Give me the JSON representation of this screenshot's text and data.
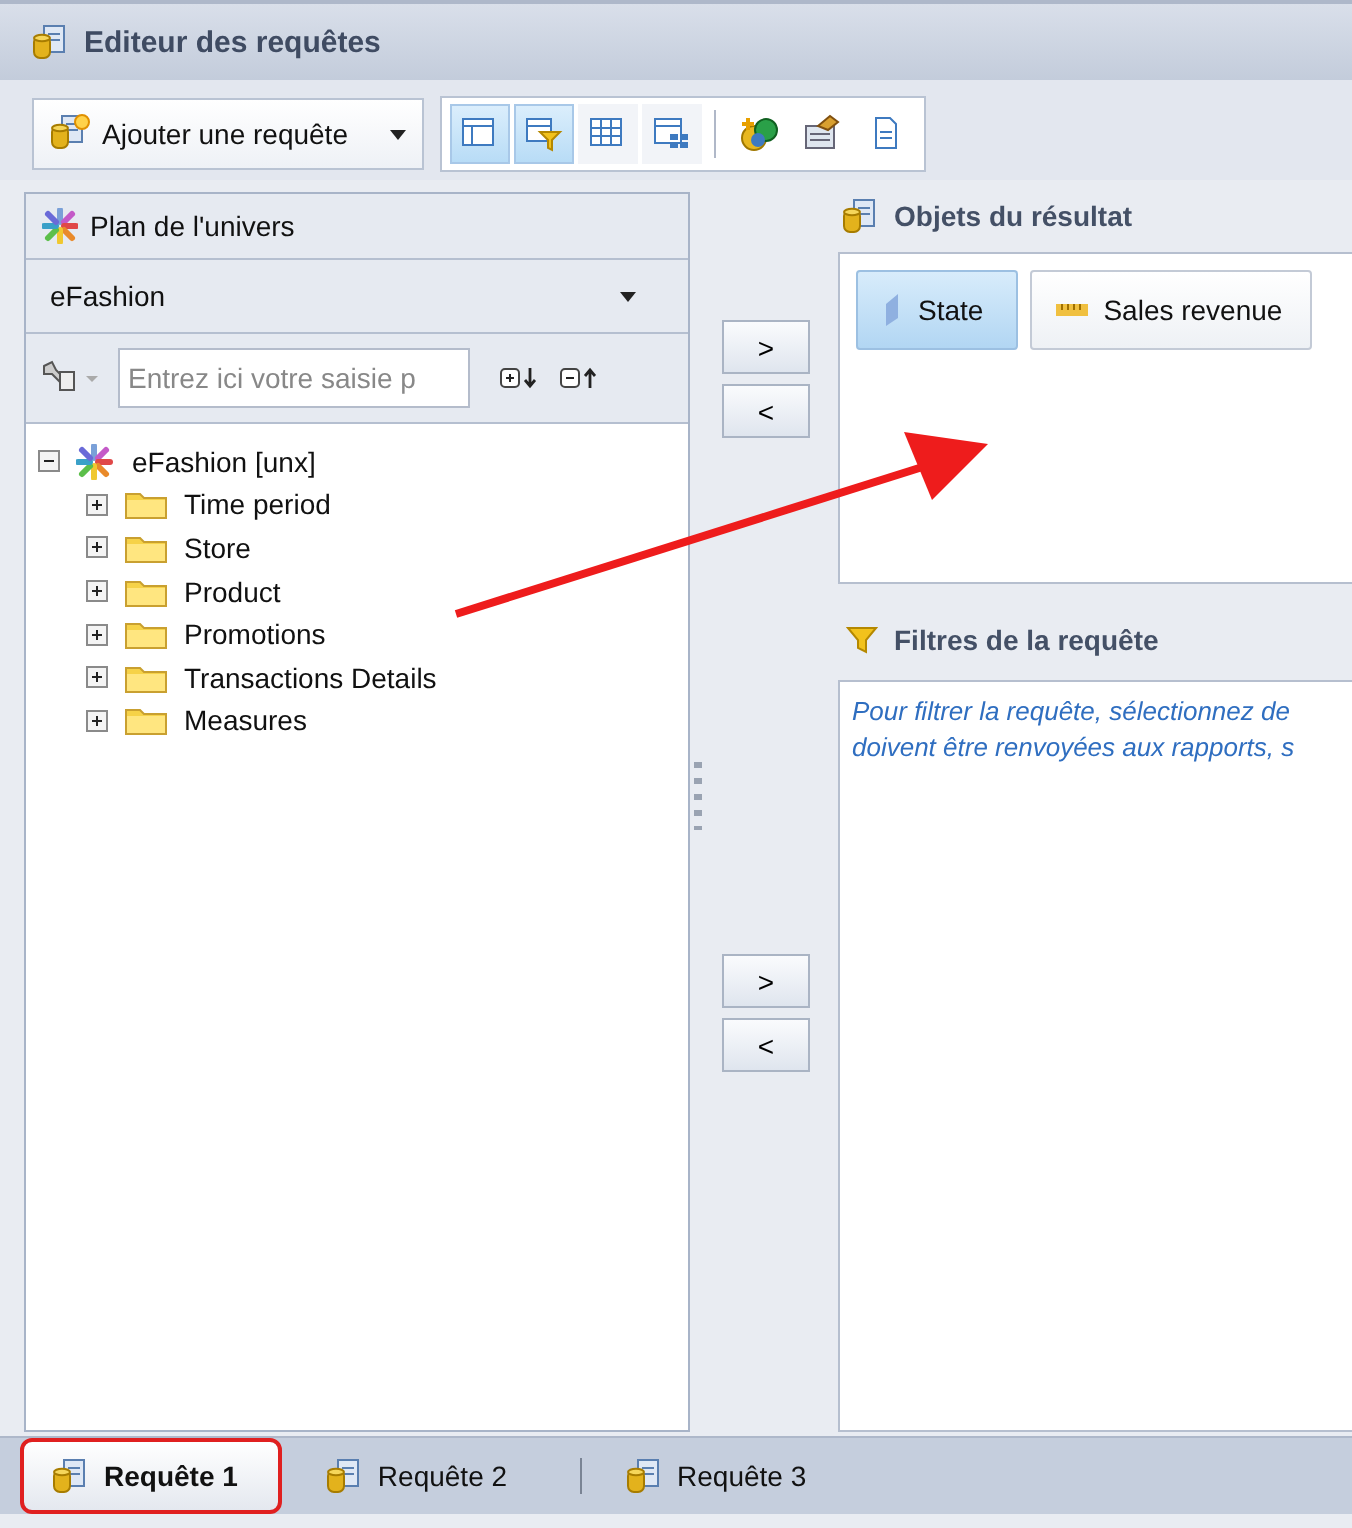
{
  "window": {
    "title": "Editeur des requêtes"
  },
  "toolbar": {
    "add_query": "Ajouter une requête",
    "view_buttons": [
      {
        "selected": true
      },
      {
        "selected": true
      },
      {
        "selected": false
      },
      {
        "selected": false
      }
    ]
  },
  "universe_panel": {
    "title": "Plan de l'univers",
    "universe": "eFashion",
    "search": {
      "placeholder": "Entrez ici votre saisie p"
    },
    "tree": [
      {
        "label": "eFashion [unx]",
        "kind": "universe",
        "expanded": true,
        "children": [
          {
            "label": "Time period",
            "kind": "folder",
            "expanded": false
          },
          {
            "label": "Store",
            "kind": "folder",
            "expanded": false
          },
          {
            "label": "Product",
            "kind": "folder",
            "expanded": false
          },
          {
            "label": "Promotions",
            "kind": "folder",
            "expanded": false
          },
          {
            "label": "Transactions Details",
            "kind": "folder",
            "expanded": false
          },
          {
            "label": "Measures",
            "kind": "folder",
            "expanded": false
          }
        ]
      }
    ]
  },
  "transfer_buttons": [
    [
      ">",
      "<"
    ],
    [
      ">",
      "<"
    ]
  ],
  "result_objects": {
    "title": "Objets du résultat",
    "items": [
      {
        "label": "State",
        "kind": "dimension",
        "selected": true
      },
      {
        "label": "Sales revenue",
        "kind": "measure",
        "selected": false
      }
    ]
  },
  "query_filters": {
    "title": "Filtres de la requête",
    "hint_lines": [
      "Pour filtrer la requête, sélectionnez de",
      "doivent être renvoyées aux rapports, s"
    ]
  },
  "tabs": [
    {
      "label": "Requête 1",
      "selected": true,
      "highlighted": true
    },
    {
      "label": "Requête 2",
      "selected": false,
      "highlighted": false
    },
    {
      "label": "Requête 3",
      "selected": false,
      "highlighted": false
    }
  ]
}
